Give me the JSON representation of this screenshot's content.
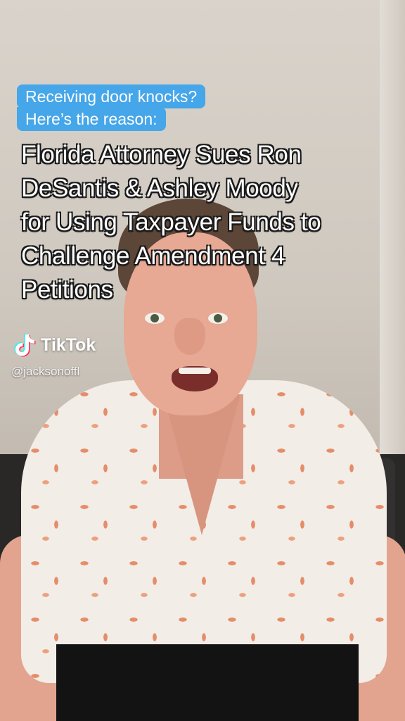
{
  "prompt": {
    "line1": "Receiving door knocks?",
    "line2": "Here’s the reason:"
  },
  "headline": {
    "lines": [
      "Florida Attorney Sues Ron",
      "DeSantis & Ashley Moody",
      "for Using Taxpayer Funds to",
      "Challenge Amendment 4",
      "Petitions"
    ]
  },
  "watermark": {
    "brand": "TikTok",
    "icon": "tiktok-note-icon",
    "handle": "@jacksonoffl"
  },
  "colors": {
    "prompt_bg": "#45a6e9",
    "headline_text": "#ffffff"
  }
}
